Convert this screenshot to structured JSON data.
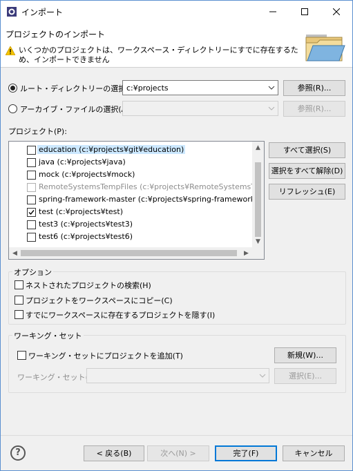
{
  "window": {
    "title": "インポート"
  },
  "header": {
    "title": "プロジェクトのインポート",
    "message": "いくつかのプロジェクトは、ワークスペース・ディレクトリーにすでに存在するため、インポートできません"
  },
  "root": {
    "radio_label": "ルート・ディレクトリーの選択(T):",
    "value": "c:¥projects",
    "browse_label": "参照(R)...",
    "selected": true
  },
  "archive": {
    "radio_label": "アーカイブ・ファイルの選択(A):",
    "value": "",
    "browse_label": "参照(R)...",
    "selected": false
  },
  "projects": {
    "label": "プロジェクト(P):",
    "items": [
      {
        "text": "education (c:¥projects¥git¥education)",
        "checked": false,
        "enabled": true,
        "selected": true
      },
      {
        "text": "java (c:¥projects¥java)",
        "checked": false,
        "enabled": true,
        "selected": false
      },
      {
        "text": "mock (c:¥projects¥mock)",
        "checked": false,
        "enabled": true,
        "selected": false
      },
      {
        "text": "RemoteSystemsTempFiles (c:¥projects¥RemoteSystemsTemp",
        "checked": false,
        "enabled": false,
        "selected": false
      },
      {
        "text": "spring-framework-master (c:¥projects¥spring-framework-m",
        "checked": false,
        "enabled": true,
        "selected": false
      },
      {
        "text": "test (c:¥projects¥test)",
        "checked": true,
        "enabled": true,
        "selected": false
      },
      {
        "text": "test3 (c:¥projects¥test3)",
        "checked": false,
        "enabled": true,
        "selected": false
      },
      {
        "text": "test6 (c:¥projects¥test6)",
        "checked": false,
        "enabled": true,
        "selected": false
      }
    ],
    "select_all_label": "すべて選択(S)",
    "deselect_all_label": "選択をすべて解除(D)",
    "refresh_label": "リフレッシュ(E)"
  },
  "options": {
    "title": "オプション",
    "search_nested": "ネストされたプロジェクトの検索(H)",
    "copy_into_workspace": "プロジェクトをワークスペースにコピー(C)",
    "hide_existing": "すでにワークスペースに存在するプロジェクトを隠す(I)"
  },
  "working_set": {
    "title": "ワーキング・セット",
    "add_label": "ワーキング・セットにプロジェクトを追加(T)",
    "new_label": "新規(W)...",
    "field_label": "ワーキング・セット(O):",
    "select_label": "選択(E)..."
  },
  "footer": {
    "help": "?",
    "back": "< 戻る(B)",
    "next": "次へ(N) >",
    "finish": "完了(F)",
    "cancel": "キャンセル"
  },
  "colors": {
    "accent": "#0078d7",
    "selection": "#cce8ff",
    "warning": "#f5c400"
  }
}
